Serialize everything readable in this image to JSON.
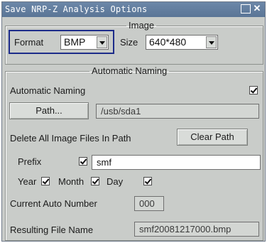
{
  "window": {
    "title": "Save NRP-Z Analysis Options"
  },
  "image_group": {
    "legend": "Image",
    "format_label": "Format",
    "format_value": "BMP",
    "size_label": "Size",
    "size_value": "640*480"
  },
  "naming_group": {
    "legend": "Automatic Naming",
    "auto_naming_label": "Automatic Naming",
    "auto_naming_checked": true,
    "path_button": "Path...",
    "path_value": "/usb/sda1",
    "delete_label": "Delete All Image Files In Path",
    "clear_path_button": "Clear Path",
    "prefix_label": "Prefix",
    "prefix_checked": true,
    "prefix_value": "smf",
    "year_label": "Year",
    "year_checked": true,
    "month_label": "Month",
    "month_checked": true,
    "day_label": "Day",
    "day_checked": true,
    "auto_number_label": "Current Auto Number",
    "auto_number_value": "000",
    "resulting_label": "Resulting File Name",
    "resulting_value": "smf20081217000.bmp"
  }
}
